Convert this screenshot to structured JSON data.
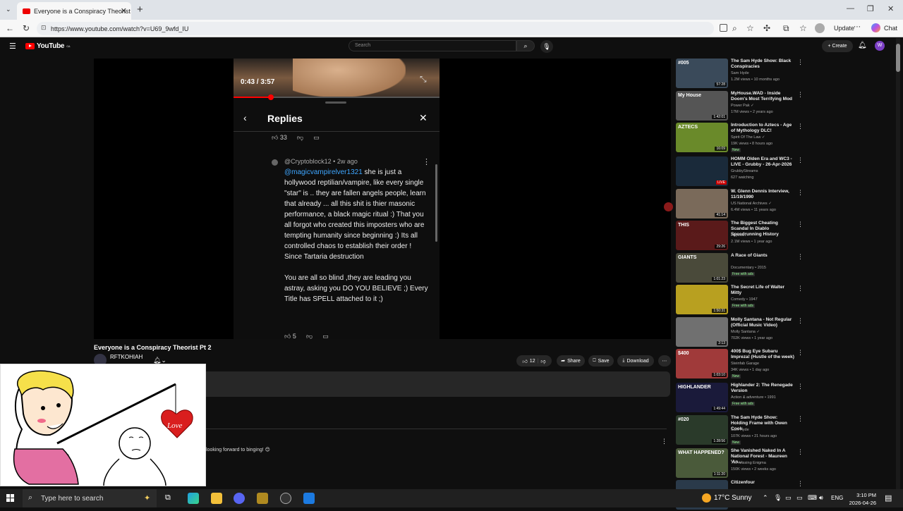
{
  "browser": {
    "tab_title": "Everyone is a Conspiracy Theorist",
    "url": "https://www.youtube.com/watch?v=U69_9wfd_IU",
    "update_label": "Update",
    "chat_label": "Chat"
  },
  "youtube": {
    "logo": "YouTube",
    "logo_sup": "CA",
    "search_placeholder": "Search",
    "create_label": "Create",
    "avatar_letter": "W"
  },
  "video": {
    "time": "0:43 / 3:57",
    "progress": 0.18,
    "replies_title": "Replies",
    "parent_likes": "33",
    "comment_author": "@Cryptoblock12",
    "comment_age": "2w ago",
    "comment_mention": "@magicvampirelver1321",
    "comment_text": " she is just a hollywood reptilian/vampire, like every single \"star\" is .. they are fallen angels people, learn that already ... all this shit is thier masonic  performance, a black magic ritual :) That you all forgot who created this imposters who are tempting humanity since beginning :) Its all controlled chaos to establish their order ! Since Tartaria destruction\n\nYou are all so blind ,they are leading you astray, asking you DO YOU BELIEVE ;) Every Title has SPELL attached to it ;)",
    "comment_likes": "5"
  },
  "info": {
    "title": "Everyone is a Conspiracy Theorist Pt 2",
    "channel": "RFTKOHIAH",
    "likes": "12",
    "share_label": "Share",
    "save_label": "Save",
    "download_label": "Download",
    "comment_snippet": "looking forward to binging! 😊"
  },
  "recommendations": [
    {
      "title": "The Sam Hyde Show: Black Conspiracies",
      "channel": "Sam Hyde",
      "meta": "1.2M views • 10 months ago",
      "duration": "57:28",
      "thumb_color": "#3a4a5a",
      "thumb_text": "#005"
    },
    {
      "title": "MyHouse.WAD - Inside Doom's Most Terrifying Mod",
      "channel": "Power Pak ✓",
      "meta": "17M views • 2 years ago",
      "duration": "1:42:01",
      "thumb_color": "#555555",
      "thumb_text": "My House"
    },
    {
      "title": "Introduction to Aztecs - Age of Mythology DLC!",
      "channel": "Spirit Of The Law ✓",
      "meta": "19K views • 8 hours ago",
      "badge": "New",
      "duration": "16:09",
      "thumb_color": "#6a8a2a",
      "thumb_text": "AZTECS"
    },
    {
      "title": "HOMM Olden Era and WC3 - LIVE - Grubby - 26-Apr-2026",
      "channel": "GrubbyStreams",
      "meta": "627 watching",
      "live": "LIVE",
      "thumb_color": "#1a2a3a",
      "thumb_text": ""
    },
    {
      "title": "W. Glenn Dennis Interview, 11/19/1990",
      "channel": "US National Archives ✓",
      "meta": "6.4M views • 11 years ago",
      "duration": "41:14",
      "thumb_color": "#7a6a5a",
      "thumb_text": ""
    },
    {
      "title": "The Biggest Cheating Scandal In Diablo Speedrunning History",
      "channel": "Abyssoft ✓",
      "meta": "2.1M views • 1 year ago",
      "duration": "29:26",
      "thumb_color": "#5a1a1a",
      "thumb_text": "THIS"
    },
    {
      "title": "A Race of Giants",
      "channel": "Documentary • 2015",
      "meta": "",
      "badge": "Free with ads",
      "duration": "1:01:23",
      "thumb_color": "#4a4a3a",
      "thumb_text": "GIANTS"
    },
    {
      "title": "The Secret Life of Walter Mitty",
      "channel": "Comedy • 1947",
      "meta": "",
      "badge": "Free with ads",
      "duration": "1:50:31",
      "thumb_color": "#b8a020",
      "thumb_text": ""
    },
    {
      "title": "Molly Santana - Not Regular (Official Music Video)",
      "channel": "Molly Santana ✓",
      "meta": "702K views • 1 year ago",
      "duration": "2:13",
      "thumb_color": "#707070",
      "thumb_text": ""
    },
    {
      "title": "400$ Bug Eye Subaru Impreza! (Hustle of the week)",
      "channel": "Steinfab Garage",
      "meta": "34K views • 1 day ago",
      "badge": "New",
      "duration": "1:03:10",
      "thumb_color": "#a03a3a",
      "thumb_text": "$400"
    },
    {
      "title": "Highlander 2: The Renegade Version",
      "channel": "Action & adventure • 1991",
      "meta": "",
      "badge": "Free with ads",
      "duration": "1:49:44",
      "thumb_color": "#1a1a3a",
      "thumb_text": "HIGHLANDER"
    },
    {
      "title": "The Sam Hyde Show: Holding Frame with Owen Cook",
      "channel": "Sam Hyde",
      "meta": "107K views • 21 hours ago",
      "badge": "New",
      "duration": "1:28:56",
      "thumb_color": "#2a3a2a",
      "thumb_text": "#020"
    },
    {
      "title": "She Vanished Naked In A National Forest - Maureen 'An...",
      "channel": "The Missing Enigma",
      "meta": "150K views • 2 weeks ago",
      "duration": "1:11:20",
      "thumb_color": "#4a5a3a",
      "thumb_text": "WHAT HAPPENED?"
    },
    {
      "title": "Citizenfour",
      "channel": "",
      "meta": "",
      "duration": "",
      "thumb_color": "#2a3a4a",
      "thumb_text": ""
    }
  ],
  "meme": {
    "heart_text": "Love"
  },
  "taskbar": {
    "search_placeholder": "Type here to search",
    "weather": "17°C  Sunny",
    "lang": "ENG",
    "time": "3:10 PM",
    "date": "2026-04-26"
  }
}
